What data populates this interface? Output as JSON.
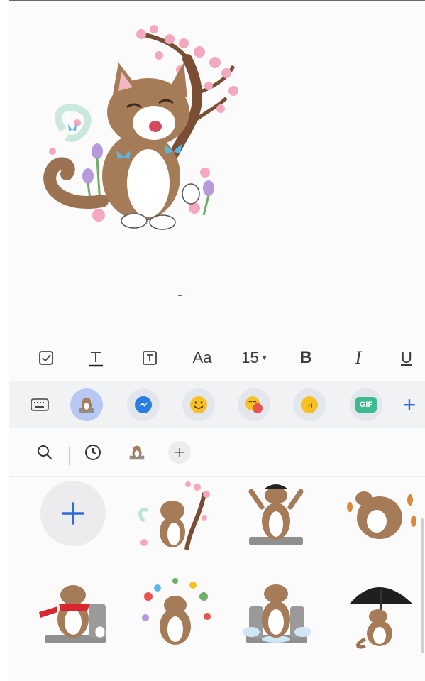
{
  "toolbar": {
    "font_size_label": "15",
    "font_label": "Aa",
    "bold_label": "B",
    "italic_label": "I",
    "underline_label": "U"
  },
  "sticker_bar": {
    "gif_label": "GIF",
    "add_label": "+"
  },
  "colors": {
    "accent": "#2f6bd8",
    "toolbar_bg": "#f1f2f4",
    "emoji_yellow": "#f6c026",
    "gif_green": "#3dbb8f"
  }
}
